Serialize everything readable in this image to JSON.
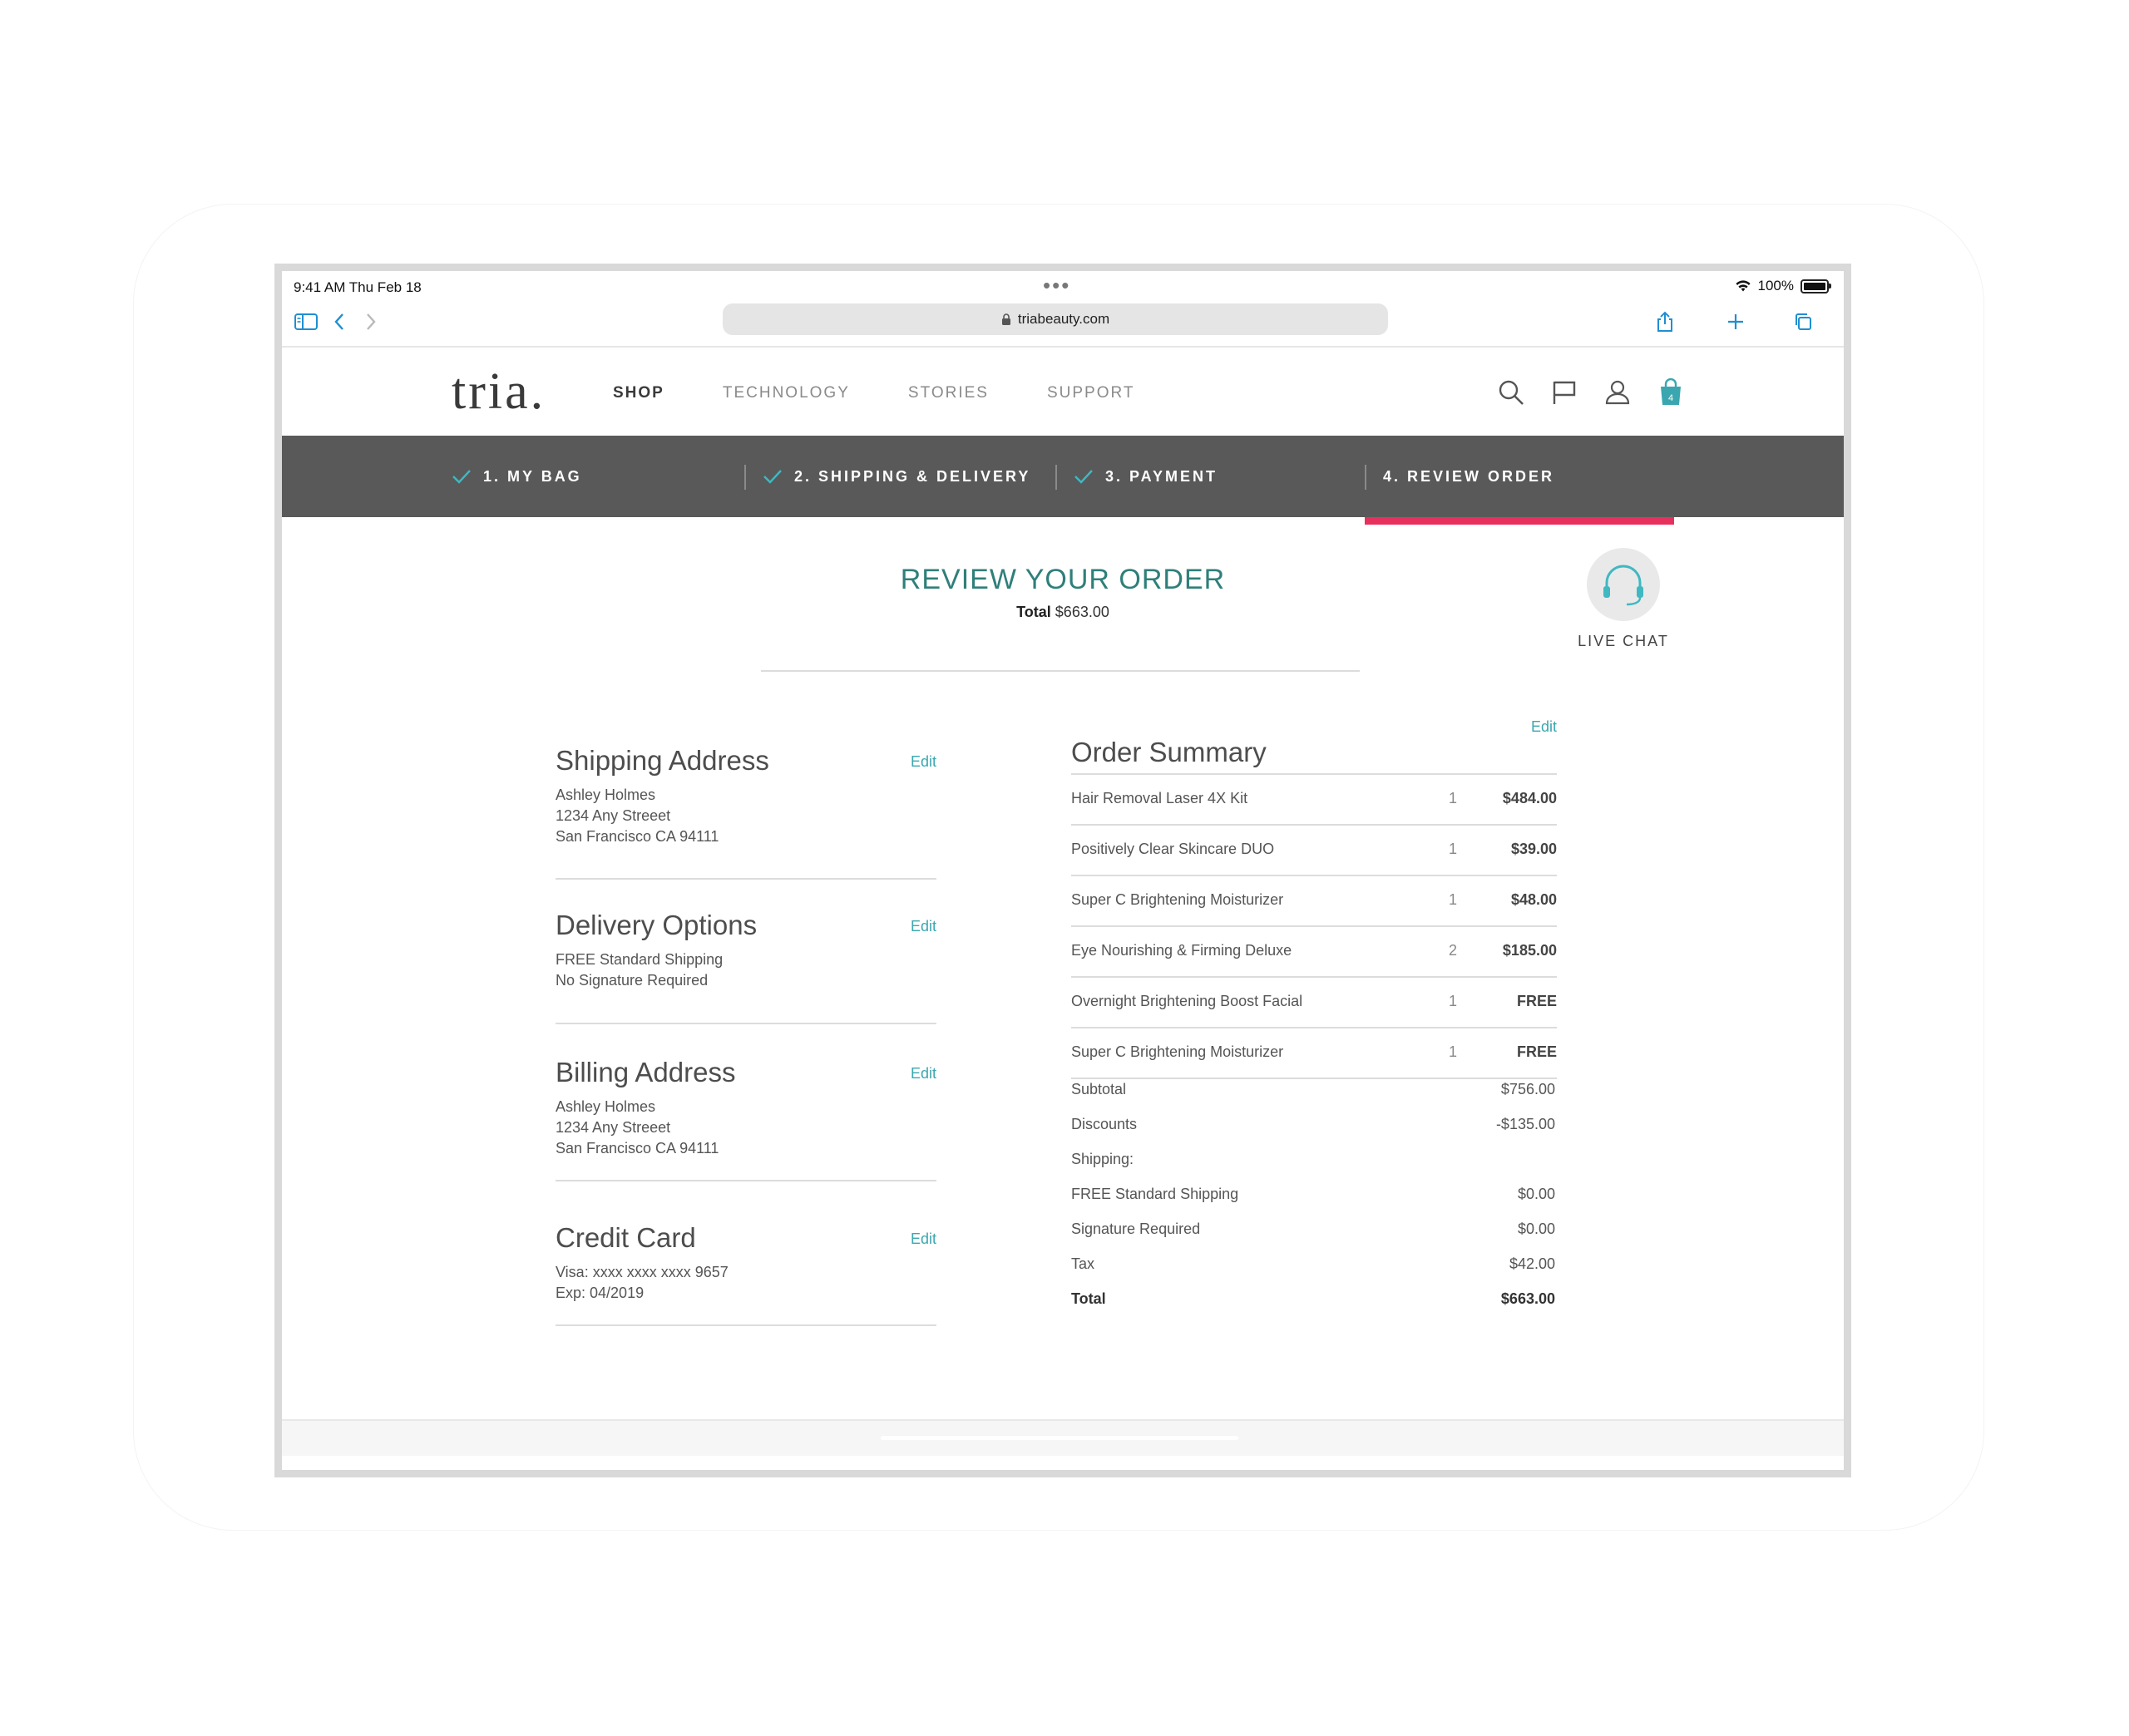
{
  "status": {
    "time": "9:41 AM   Thu Feb 18",
    "dots": "•••",
    "battery": "100%"
  },
  "browser": {
    "url": "triabeauty.com"
  },
  "site": {
    "logo": "tria.",
    "nav": [
      "SHOP",
      "TECHNOLOGY",
      "STORIES",
      "SUPPORT"
    ],
    "cart_count": "4"
  },
  "steps": [
    "1. MY BAG",
    "2. SHIPPING & DELIVERY",
    "3. PAYMENT",
    "4. REVIEW ORDER"
  ],
  "review": {
    "title": "REVIEW YOUR ORDER",
    "total_label": "Total",
    "total_value": "$663.00",
    "live_chat": "LIVE CHAT"
  },
  "shipping": {
    "title": "Shipping Address",
    "edit": "Edit",
    "lines": [
      "Ashley Holmes",
      "1234 Any Streeet",
      "San Francisco CA 94111"
    ]
  },
  "delivery": {
    "title": "Delivery Options",
    "edit": "Edit",
    "lines": [
      "FREE Standard Shipping",
      "No Signature Required"
    ]
  },
  "billing": {
    "title": "Billing Address",
    "edit": "Edit",
    "lines": [
      "Ashley Holmes",
      "1234 Any Streeet",
      "San Francisco CA 94111"
    ]
  },
  "card": {
    "title": "Credit Card",
    "edit": "Edit",
    "lines": [
      "Visa: xxxx xxxx xxxx  9657",
      "Exp: 04/2019"
    ]
  },
  "summary": {
    "title": "Order Summary",
    "edit": "Edit",
    "items": [
      {
        "name": "Hair Removal Laser 4X Kit",
        "qty": "1",
        "price": "$484.00"
      },
      {
        "name": "Positively Clear Skincare DUO",
        "qty": "1",
        "price": "$39.00"
      },
      {
        "name": "Super C Brightening Moisturizer",
        "qty": "1",
        "price": "$48.00"
      },
      {
        "name": "Eye Nourishing & Firming Deluxe",
        "qty": "2",
        "price": "$185.00"
      },
      {
        "name": "Overnight Brightening Boost Facial",
        "qty": "1",
        "price": "FREE"
      },
      {
        "name": "Super C Brightening Moisturizer",
        "qty": "1",
        "price": "FREE"
      }
    ],
    "totals": [
      {
        "label": "Subtotal",
        "value": "$756.00"
      },
      {
        "label": "Discounts",
        "value": "-$135.00"
      },
      {
        "label": "Shipping:",
        "value": ""
      },
      {
        "label": "FREE Standard Shipping",
        "value": "$0.00"
      },
      {
        "label": "Signature Required",
        "value": "$0.00"
      },
      {
        "label": "Tax",
        "value": "$42.00"
      },
      {
        "label": "Total",
        "value": "$663.00"
      }
    ]
  },
  "colors": {
    "accent": "#3aa7b0",
    "title": "#2f7f7a",
    "step_bar": "#595959",
    "step_active": "#e8305e"
  }
}
